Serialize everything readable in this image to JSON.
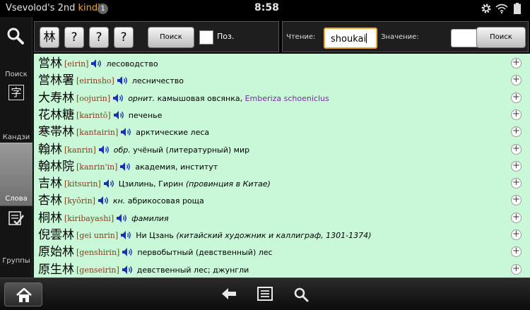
{
  "status": {
    "device_name": "Vsevolod's 2nd",
    "device_brand": "kindle",
    "notification_count": "1",
    "time": "8:58"
  },
  "sidebar": {
    "search_label": "Поиск",
    "kanji_glyph": "字",
    "kanji_label": "Кандзи",
    "words_label": "Слова",
    "groups_label": "Группы"
  },
  "toolbar": {
    "kanji_button": "林",
    "wildcard_1": "?",
    "wildcard_2": "?",
    "wildcard_3": "?",
    "search_button": "Поиск",
    "position_label": "Поз.",
    "reading_label": "Чтение:",
    "reading_value": "shoukai",
    "meaning_label": "Значение:",
    "meaning_value": "",
    "search_button_2": "Поиск"
  },
  "entries": [
    {
      "word": "営林",
      "reading": "[eirin]",
      "parts": [
        {
          "t": "лесоводство",
          "s": "n"
        }
      ]
    },
    {
      "word": "営林署",
      "reading": "[eirinsho]",
      "parts": [
        {
          "t": "лесничество",
          "s": "n"
        }
      ]
    },
    {
      "word": "大寿林",
      "reading": "[oojurin]",
      "parts": [
        {
          "t": "орнит.",
          "s": "i"
        },
        {
          "t": " камышовая овсянка, ",
          "s": "n"
        },
        {
          "t": "Emberiza schoeniclus",
          "s": "l"
        }
      ]
    },
    {
      "word": "花林糖",
      "reading": "[karintō]",
      "parts": [
        {
          "t": "печенье",
          "s": "n"
        }
      ]
    },
    {
      "word": "寒帯林",
      "reading": "[kantairin]",
      "parts": [
        {
          "t": "арктические леса",
          "s": "n"
        }
      ]
    },
    {
      "word": "翰林",
      "reading": "[kanrin]",
      "parts": [
        {
          "t": "обр.",
          "s": "i"
        },
        {
          "t": " учёный (литературный) мир",
          "s": "n"
        }
      ]
    },
    {
      "word": "翰林院",
      "reading": "[kanrin'in]",
      "parts": [
        {
          "t": "академия, институт",
          "s": "n"
        }
      ]
    },
    {
      "word": "吉林",
      "reading": "[kitsurin]",
      "parts": [
        {
          "t": "Цзилинь, Гирин ",
          "s": "n"
        },
        {
          "t": "(провинция в Китае)",
          "s": "i"
        }
      ]
    },
    {
      "word": "杏林",
      "reading": "[kyōrin]",
      "parts": [
        {
          "t": "кн.",
          "s": "i"
        },
        {
          "t": " абрикосовая роща",
          "s": "n"
        }
      ]
    },
    {
      "word": "桐林",
      "reading": "[kiribayashi]",
      "parts": [
        {
          "t": "фамилия",
          "s": "i"
        }
      ]
    },
    {
      "word": "倪雲林",
      "reading": "[gei unrin]",
      "parts": [
        {
          "t": "Ни Цзань ",
          "s": "n"
        },
        {
          "t": "(китайский художник и каллиграф, 1301-1374)",
          "s": "i"
        }
      ]
    },
    {
      "word": "原始林",
      "reading": "[genshirin]",
      "parts": [
        {
          "t": "первобытный (девственный) лес",
          "s": "n"
        }
      ]
    },
    {
      "word": "原生林",
      "reading": "[genseirin]",
      "parts": [
        {
          "t": "девственный лес; джунгли",
          "s": "n"
        }
      ]
    }
  ],
  "colors": {
    "results_bg": "#c8f8d8",
    "reading_color": "#8a3a1a",
    "latin_color": "#7a2aa0",
    "speaker_color": "#1a2fb8",
    "focus_border": "#f0a830"
  },
  "icons": {
    "speaker": "speaker-icon",
    "add": "plus-circle-icon",
    "home": "home-icon",
    "back": "back-arrow-icon",
    "menu": "menu-icon",
    "search": "search-icon",
    "settings": "gear-icon",
    "wifi": "wifi-icon",
    "battery": "battery-icon"
  }
}
